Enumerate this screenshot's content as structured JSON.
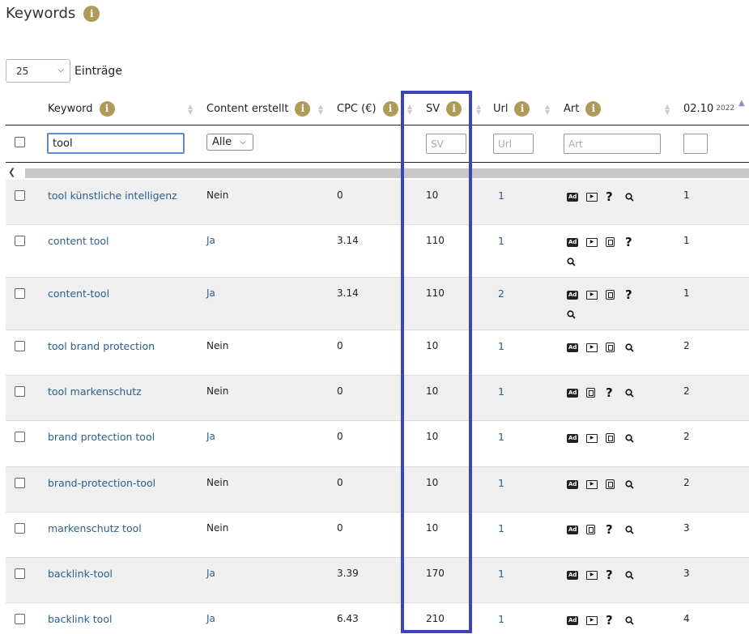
{
  "page": {
    "title": "Keywords"
  },
  "entries": {
    "value": "25",
    "label": "Einträge"
  },
  "columns": {
    "keyword": "Keyword",
    "content": "Content erstellt",
    "cpc": "CPC (€)",
    "sv": "SV",
    "url": "Url",
    "art": "Art",
    "date": "02.10",
    "date_year": "2022"
  },
  "filters": {
    "keyword_value": "tool",
    "content_value": "Alle",
    "sv_placeholder": "SV",
    "url_placeholder": "Url",
    "art_placeholder": "Art"
  },
  "rows": [
    {
      "keyword": "tool künstliche intelligenz",
      "content": "Nein",
      "cpc": "0",
      "sv": "10",
      "url": "1",
      "art": [
        "ad-icon",
        "video-icon",
        "question-icon",
        "search-icon"
      ],
      "rank": "1"
    },
    {
      "keyword": "content tool",
      "content": "Ja",
      "cpc": "3.14",
      "sv": "110",
      "url": "1",
      "art": [
        "ad-icon",
        "video-icon",
        "news-icon",
        "question-icon",
        "search-icon"
      ],
      "rank": "1"
    },
    {
      "keyword": "content-tool",
      "content": "Ja",
      "cpc": "3.14",
      "sv": "110",
      "url": "2",
      "art": [
        "ad-icon",
        "video-icon",
        "news-icon",
        "question-icon",
        "search-icon"
      ],
      "rank": "1"
    },
    {
      "keyword": "tool brand protection",
      "content": "Nein",
      "cpc": "0",
      "sv": "10",
      "url": "1",
      "art": [
        "ad-icon",
        "video-icon",
        "news-icon",
        "search-icon"
      ],
      "rank": "2"
    },
    {
      "keyword": "tool markenschutz",
      "content": "Nein",
      "cpc": "0",
      "sv": "10",
      "url": "1",
      "art": [
        "ad-icon",
        "news-icon",
        "question-icon",
        "search-icon"
      ],
      "rank": "2"
    },
    {
      "keyword": "brand protection tool",
      "content": "Ja",
      "cpc": "0",
      "sv": "10",
      "url": "1",
      "art": [
        "ad-icon",
        "video-icon",
        "news-icon",
        "search-icon"
      ],
      "rank": "2"
    },
    {
      "keyword": "brand-protection-tool",
      "content": "Nein",
      "cpc": "0",
      "sv": "10",
      "url": "1",
      "art": [
        "ad-icon",
        "video-icon",
        "news-icon",
        "search-icon"
      ],
      "rank": "2"
    },
    {
      "keyword": "markenschutz tool",
      "content": "Nein",
      "cpc": "0",
      "sv": "10",
      "url": "1",
      "art": [
        "ad-icon",
        "news-icon",
        "question-icon",
        "search-icon"
      ],
      "rank": "3"
    },
    {
      "keyword": "backlink-tool",
      "content": "Ja",
      "cpc": "3.39",
      "sv": "170",
      "url": "1",
      "art": [
        "ad-icon",
        "video-icon",
        "question-icon",
        "search-icon"
      ],
      "rank": "3"
    },
    {
      "keyword": "backlink tool",
      "content": "Ja",
      "cpc": "6.43",
      "sv": "210",
      "url": "1",
      "art": [
        "ad-icon",
        "video-icon",
        "question-icon",
        "search-icon"
      ],
      "rank": "4"
    }
  ],
  "colors": {
    "accent_info": "#b09a58",
    "link": "#2b5f8e",
    "highlight": "#3d45b5"
  }
}
